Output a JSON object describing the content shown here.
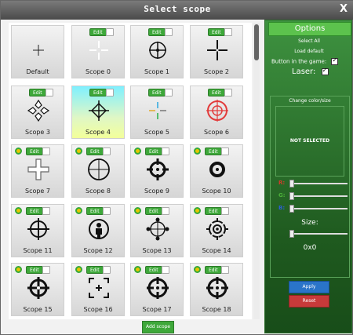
{
  "window": {
    "title": "Select scope",
    "close_label": "X"
  },
  "edit_label": "Edit",
  "add_scope_label": "Add scope",
  "scopes": [
    {
      "label": "Default",
      "icon": "plus-small",
      "selected": false,
      "edit": false,
      "dot": false
    },
    {
      "label": "Scope 0",
      "icon": "cross-gap-white",
      "selected": false,
      "edit": true,
      "dot": false
    },
    {
      "label": "Scope 1",
      "icon": "circle-crosshair",
      "selected": false,
      "edit": true,
      "dot": false
    },
    {
      "label": "Scope 2",
      "icon": "cross-thick",
      "selected": false,
      "edit": true,
      "dot": false
    },
    {
      "label": "Scope 3",
      "icon": "arrows-four",
      "selected": false,
      "edit": true,
      "dot": false
    },
    {
      "label": "Scope 4",
      "icon": "diamond-cross",
      "selected": true,
      "edit": true,
      "dot": false
    },
    {
      "label": "Scope 5",
      "icon": "color-cross",
      "selected": false,
      "edit": true,
      "dot": false
    },
    {
      "label": "Scope 6",
      "icon": "red-crosshair",
      "selected": false,
      "edit": true,
      "dot": false
    },
    {
      "label": "Scope 7",
      "icon": "outline-cross",
      "selected": false,
      "edit": true,
      "dot": true
    },
    {
      "label": "Scope 8",
      "icon": "sniper-crosshair",
      "selected": false,
      "edit": true,
      "dot": true
    },
    {
      "label": "Scope 9",
      "icon": "bold-crosshair",
      "selected": false,
      "edit": true,
      "dot": true
    },
    {
      "label": "Scope 10",
      "icon": "ring-crosshair",
      "selected": false,
      "edit": true,
      "dot": true
    },
    {
      "label": "Scope 11",
      "icon": "thin-crosshair",
      "selected": false,
      "edit": true,
      "dot": true
    },
    {
      "label": "Scope 12",
      "icon": "person-crosshair",
      "selected": false,
      "edit": true,
      "dot": true
    },
    {
      "label": "Scope 13",
      "icon": "ball-crosshair",
      "selected": false,
      "edit": true,
      "dot": true
    },
    {
      "label": "Scope 14",
      "icon": "target-crosshair",
      "selected": false,
      "edit": true,
      "dot": true
    },
    {
      "label": "Scope 15",
      "icon": "thick-ring-crosshair",
      "selected": false,
      "edit": true,
      "dot": true
    },
    {
      "label": "Scope 16",
      "icon": "corner-brackets",
      "selected": false,
      "edit": true,
      "dot": true
    },
    {
      "label": "Scope 17",
      "icon": "large-ring-crosshair",
      "selected": false,
      "edit": true,
      "dot": true
    },
    {
      "label": "Scope 18",
      "icon": "large-ring-crosshair-2",
      "selected": false,
      "edit": true,
      "dot": true
    }
  ],
  "options": {
    "title": "Options",
    "select_all": "Select All",
    "load_default": "Load default",
    "button_in_game": "Button in the game:",
    "laser": "Laser:",
    "change_color": "Change color/size",
    "not_selected": "NOT SELECTED",
    "r_label": "R:",
    "g_label": "G:",
    "b_label": "B:",
    "r_color": "#d23a2a",
    "g_color": "#4caf3a",
    "b_color": "#2a5fd6",
    "size_label": "Size:",
    "size_value": "0x0",
    "apply": "Apply",
    "reset": "Reset"
  }
}
